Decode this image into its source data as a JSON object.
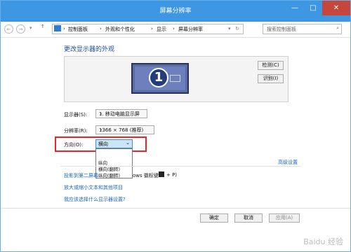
{
  "window": {
    "title": "屏幕分辨率"
  },
  "address": {
    "crumbs": [
      "控制面板",
      "外观和个性化",
      "显示",
      "屏幕分辨率"
    ],
    "search_placeholder": "搜索控制面板"
  },
  "heading": "更改显示器的外观",
  "buttons": {
    "detect": "检测(C)",
    "identify": "识别(I)",
    "ok": "确定",
    "cancel": "取消",
    "apply": "应用(A)"
  },
  "fields": {
    "display_label": "显示器(S):",
    "display_value": "1. 移动电脑显示屏",
    "resolution_label": "分辨率(R):",
    "resolution_value": "1366 × 768 (推荐)",
    "orientation_label": "方向(O):",
    "orientation_value": "横向"
  },
  "orientation_options": [
    "纵向",
    "横向(翻转)",
    "纵向(翻转)"
  ],
  "links": {
    "advanced": "高级设置",
    "project_prefix": "投影到第二屏幕",
    "project_suffix": "ows 徽标键",
    "project_key": "+ P)",
    "text_size": "放大或缩小文本和其他项目",
    "which_settings": "我应该选择什么显示器设置?"
  },
  "watermark": "Baidu 经验",
  "colors": {
    "accent": "#3d97e3",
    "highlight": "#e2282b",
    "link": "#1d67bd"
  },
  "icons": [
    "back-icon",
    "forward-icon",
    "up-icon",
    "control-panel-icon",
    "search-icon",
    "refresh-icon",
    "windows-logo-icon"
  ]
}
